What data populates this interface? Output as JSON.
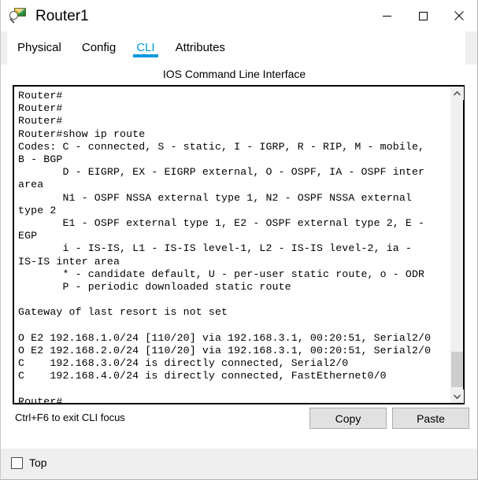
{
  "window": {
    "title": "Router1",
    "icon": "router-magnifier-icon",
    "controls": {
      "minimize": "minimize-icon",
      "maximize": "maximize-icon",
      "close": "close-icon"
    }
  },
  "tabs": [
    {
      "label": "Physical",
      "active": false
    },
    {
      "label": "Config",
      "active": false
    },
    {
      "label": "CLI",
      "active": true
    },
    {
      "label": "Attributes",
      "active": false
    }
  ],
  "accent_color": "#0099dd",
  "cli": {
    "header": "IOS Command Line Interface",
    "content": "Router#\nRouter#\nRouter#\nRouter#show ip route\nCodes: C - connected, S - static, I - IGRP, R - RIP, M - mobile,\nB - BGP\n       D - EIGRP, EX - EIGRP external, O - OSPF, IA - OSPF inter\narea\n       N1 - OSPF NSSA external type 1, N2 - OSPF NSSA external\ntype 2\n       E1 - OSPF external type 1, E2 - OSPF external type 2, E -\nEGP\n       i - IS-IS, L1 - IS-IS level-1, L2 - IS-IS level-2, ia -\nIS-IS inter area\n       * - candidate default, U - per-user static route, o - ODR\n       P - periodic downloaded static route\n\nGateway of last resort is not set\n\nO E2 192.168.1.0/24 [110/20] via 192.168.3.1, 00:20:51, Serial2/0\nO E2 192.168.2.0/24 [110/20] via 192.168.3.1, 00:20:51, Serial2/0\nC    192.168.3.0/24 is directly connected, Serial2/0\nC    192.168.4.0/24 is directly connected, FastEthernet0/0\n\nRouter#",
    "scrollbar": {
      "up_arrow": "chevron-up-icon",
      "down_arrow": "chevron-down-icon"
    }
  },
  "bottom": {
    "hint": "Ctrl+F6 to exit CLI focus",
    "copy_label": "Copy",
    "paste_label": "Paste"
  },
  "footer": {
    "top_label": "Top",
    "top_checked": false
  }
}
